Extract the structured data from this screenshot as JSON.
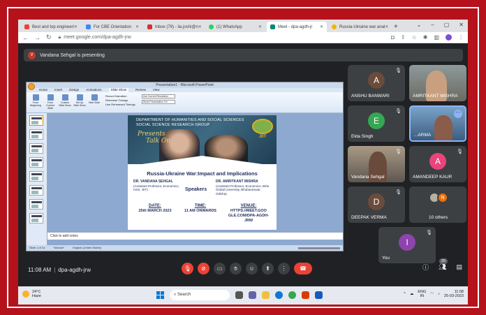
{
  "browser": {
    "tabs": [
      {
        "label": "Best and top engineeri",
        "color": "#ea4335"
      },
      {
        "label": "For CBE Orientation",
        "color": "#4285f4"
      },
      {
        "label": "Inbox (79) - ila.joshi@n",
        "color": "#d93025"
      },
      {
        "label": "(1) WhatsApp",
        "color": "#25d366"
      },
      {
        "label": "Meet - dpa-agdh-jr",
        "color": "#00897b",
        "active": true
      },
      {
        "label": "Russia-Ukraine war anal",
        "color": "#f4b400"
      }
    ],
    "url": "meet.google.com/dpa-agdh-jrw"
  },
  "banner": {
    "avatar_letter": "V",
    "text": "Vandana Sehgal is presenting"
  },
  "powerpoint": {
    "window_title": "Presentation1 - Microsoft PowerPoint",
    "menus": [
      "Home",
      "Insert",
      "Design",
      "Animations",
      "Slide Show",
      "Review",
      "View"
    ],
    "active_menu": "Slide Show",
    "ribbon_buttons": [
      "From Beginning",
      "From Current Slide",
      "Custom Slide Show",
      "Set Up Slide Show",
      "Hide Slide"
    ],
    "ribbon_options": [
      "Record Narration",
      "Rehearse Timings",
      "Use Rehearsed Timings"
    ],
    "ribbon_dropdowns": [
      "Use Current Resolution",
      "Show Presentation On"
    ],
    "notes_placeholder": "Click to add notes",
    "status": [
      "Slide 1 of 14",
      "\"Module\"",
      "English (United States)"
    ]
  },
  "poster": {
    "department": "DEPARTMENT OF HUMANITIES AND SOCIAL SCIENCES SOCIAL SCIENCE RESEARCH GROUP",
    "presents": "Presents",
    "talk_on": "Talk On",
    "logo_text": "JIIT",
    "heading": "Russia-Ukraine War:Impact and Implications",
    "speaker1_name": "DR. VANDANA SEHGAL",
    "speaker1_detail": "(Assistant Professor, Economics, HSS, JIIT)",
    "speakers_label": "Speakers",
    "speaker2_name": "DR. AMRITKANT MISHRA",
    "speaker2_detail": "(Assistant Professor, Economics, Birla Global University, Bhubaneswar, Odisha)",
    "date_label": "DATE:",
    "date_value": "25th MARCH 2023",
    "time_label": "TIME:",
    "time_value": "11 AM ONWARDS",
    "venue_label": "VENUE:",
    "venue_value": "HTTPS://MEET.GOO GLE.COM/DPA-AGDH-JRW"
  },
  "participants": [
    {
      "name": "ANSHU BANWARI",
      "letter": "A",
      "color": "#6b4c3b"
    },
    {
      "name": "AMRITKANT MISHRA",
      "video": true
    },
    {
      "name": "Ekta Singh",
      "letter": "E",
      "color": "#34a853"
    },
    {
      "name": "...ARMA",
      "video": true
    },
    {
      "name": "Vandana Sehgal",
      "video": true
    },
    {
      "name": "AMANDEEP KAUR",
      "letter": "A",
      "color": "#e8457a"
    },
    {
      "name": "DEEPAK VERMA",
      "letter": "D",
      "color": "#6b4c3b"
    },
    {
      "name": "10 others",
      "letter": "N",
      "color": "#e8710a"
    },
    {
      "name": "You",
      "letter": "I",
      "color": "#8e44ad"
    }
  ],
  "controls": {
    "time": "11:08 AM",
    "meeting_code": "dpa-agdh-jrw",
    "people_count": "20"
  },
  "taskbar": {
    "temp": "24°C",
    "weather": "Haze",
    "search_placeholder": "Search",
    "lang": "ENG",
    "region": "IN",
    "time": "11:08",
    "date": "25-03-2023"
  }
}
